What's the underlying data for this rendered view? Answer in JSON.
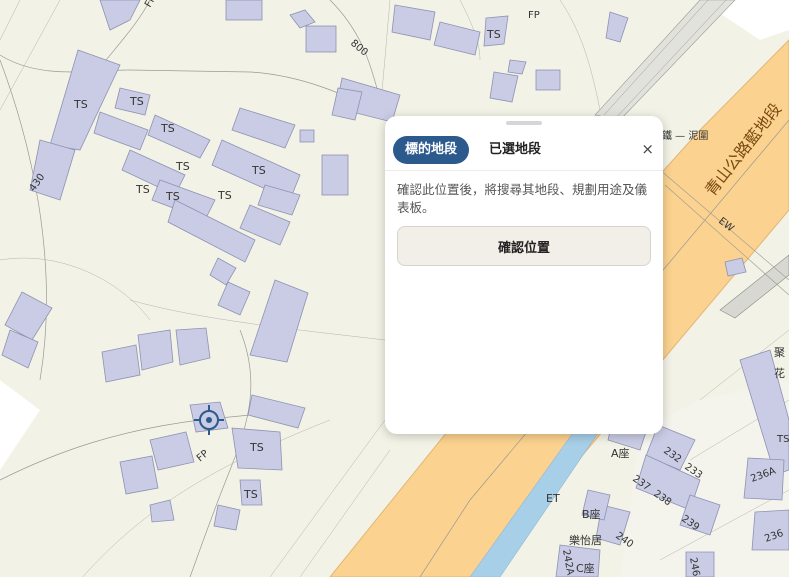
{
  "panel": {
    "tabs": [
      {
        "label": "標的地段",
        "active": true
      },
      {
        "label": "已選地段",
        "active": false
      }
    ],
    "close_label": "×",
    "description": "確認此位置後，將搜尋其地段、規劃用途及儀表板。",
    "confirm_label": "確認位置"
  },
  "map": {
    "labels": {
      "ts": "TS",
      "fp": "FP",
      "lbl_800": "800",
      "lbl_430": "430",
      "ew": "EW",
      "et": "ET",
      "railway": "鐵 — 泥圍",
      "highway": "青山公路藍地段",
      "a_block": "A座",
      "b_block": "B座",
      "c_block": "C座",
      "estate": "樂怡居",
      "lbl_232": "232",
      "lbl_233": "233",
      "lbl_237": "237",
      "lbl_238": "238",
      "lbl_239": "239",
      "lbl_240": "240",
      "lbl_236a": "236A",
      "lbl_236": "236",
      "lbl_242a": "242A",
      "lbl_246": "246",
      "edge_1": "聚",
      "edge_2": "花"
    },
    "colors": {
      "background": "#f2f2e6",
      "building": "#c9cce4",
      "highway": "#fbd28f",
      "river": "#a7cfe8"
    },
    "marker_icon": "crosshair-location-icon"
  }
}
